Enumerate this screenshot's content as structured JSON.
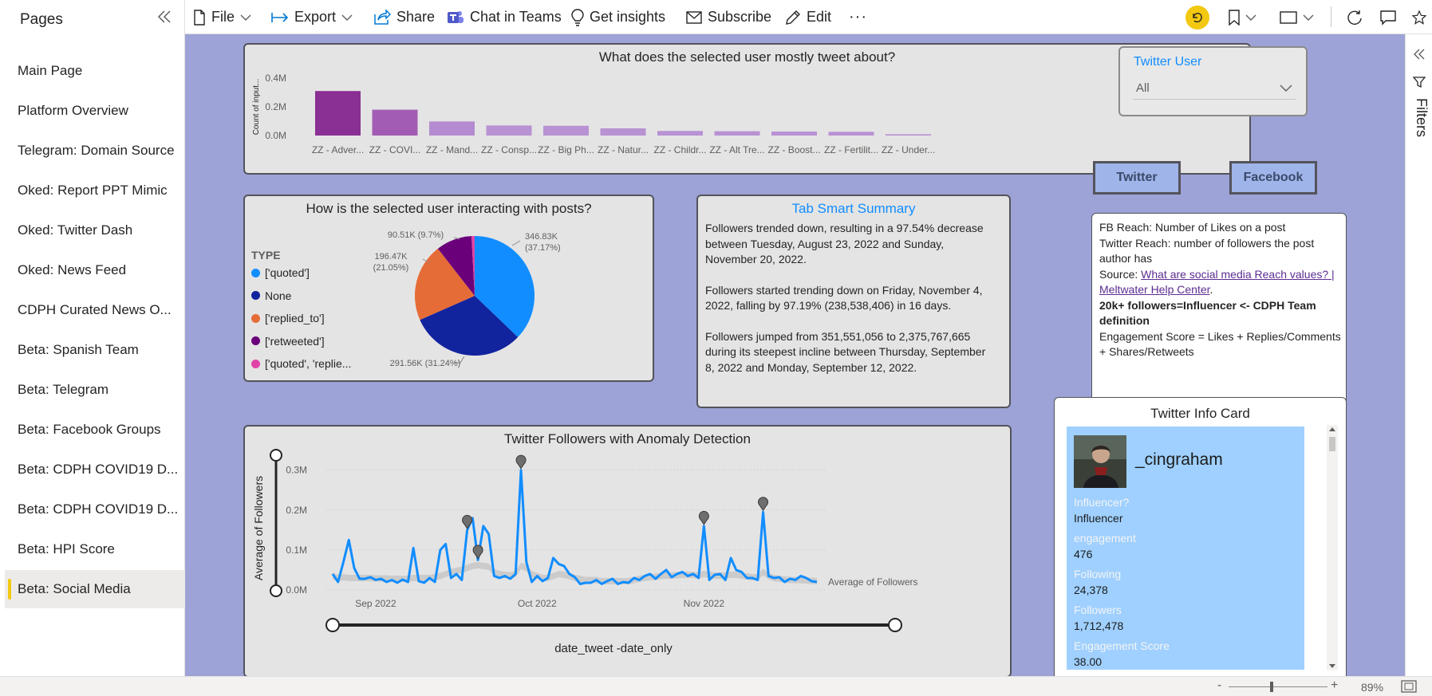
{
  "pages_pane": {
    "title": "Pages",
    "items": [
      {
        "label": "Main Page"
      },
      {
        "label": "Platform Overview"
      },
      {
        "label": "Telegram: Domain Source"
      },
      {
        "label": "Oked: Report PPT Mimic"
      },
      {
        "label": "Oked: Twitter Dash"
      },
      {
        "label": "Oked: News Feed"
      },
      {
        "label": "CDPH Curated News O..."
      },
      {
        "label": "Beta: Spanish Team"
      },
      {
        "label": "Beta: Telegram"
      },
      {
        "label": "Beta: Facebook Groups"
      },
      {
        "label": "Beta: CDPH COVID19 D..."
      },
      {
        "label": "Beta: CDPH COVID19 D..."
      },
      {
        "label": "Beta: HPI Score"
      },
      {
        "label": "Beta: Social Media"
      }
    ],
    "active_index": 13
  },
  "toolbar": {
    "file": "File",
    "export": "Export",
    "share": "Share",
    "chat_in_teams": "Chat in Teams",
    "get_insights": "Get insights",
    "subscribe": "Subscribe",
    "edit": "Edit",
    "more": "···"
  },
  "filters_pane": {
    "label": "Filters"
  },
  "status_bar": {
    "zoom": "89%",
    "minus": "-",
    "plus": "+"
  },
  "slicer": {
    "title": "Twitter User",
    "selected": "All"
  },
  "buttons": {
    "twitter": "Twitter",
    "facebook": "Facebook"
  },
  "smart_summary": {
    "title": "Tab Smart Summary",
    "paragraphs": [
      "Followers trended down, resulting in a 97.54% decrease between Tuesday, August 23, 2022 and Sunday, November 20, 2022.",
      "Followers started trending down on Friday, November 4, 2022, falling by 97.19% (238,538,406) in 16 days.",
      "Followers jumped from 351,551,056 to 2,375,767,665 during its steepest incline between Thursday, September 8, 2022 and Monday, September 12, 2022."
    ]
  },
  "info_text": {
    "line1": "FB Reach: Number of Likes on a post",
    "line2": "Twitter Reach: number of followers the post author has",
    "source_prefix": "Source: ",
    "source_link": "What are social media Reach values? | Meltwater Help Center",
    "source_suffix": ".",
    "bold_def": "20k+ followers=Influencer <- CDPH Team definition",
    "engagement_def": "Engagement Score = Likes + Replies/Comments + Shares/Retweets"
  },
  "info_card": {
    "title": "Twitter Info Card",
    "username": "_cingraham",
    "fields": [
      {
        "label": "Influencer?",
        "value": "Influencer"
      },
      {
        "label": "engagement",
        "value": "476"
      },
      {
        "label": "Following",
        "value": "24,378"
      },
      {
        "label": "Followers",
        "value": "1,712,478"
      },
      {
        "label": "Engagement Score",
        "value": "38.00"
      }
    ]
  },
  "chart_data": [
    {
      "type": "bar",
      "title": "What does the selected user mostly tweet about?",
      "ylabel": "Count of input...",
      "ytick_labels": [
        "0.0M",
        "0.2M",
        "0.4M"
      ],
      "ylim": [
        0,
        400000
      ],
      "categories": [
        "ZZ - Adver...",
        "ZZ - COVI...",
        "ZZ - Mand...",
        "ZZ - Consp...",
        "ZZ - Big Ph...",
        "ZZ - Natur...",
        "ZZ - Childr...",
        "ZZ - Alt Tre...",
        "ZZ - Boost...",
        "ZZ - Fertilit...",
        "ZZ - Under..."
      ],
      "values": [
        310000,
        180000,
        98000,
        70000,
        68000,
        50000,
        32000,
        30000,
        28000,
        26000,
        9000
      ],
      "colors": [
        "#8a2f94",
        "#a35cb3",
        "#b48bd0",
        "#b892d3",
        "#b892d3",
        "#b892d3",
        "#b892d3",
        "#b892d3",
        "#b892d3",
        "#b892d3",
        "#b892d3"
      ]
    },
    {
      "type": "pie",
      "title": "How is the selected user interacting with posts?",
      "legend_title": "TYPE",
      "legend_position": "left",
      "slices": [
        {
          "name": "['quoted']",
          "value": 346830,
          "label": "346.83K (37.17%)",
          "color": "#118dff"
        },
        {
          "name": "None",
          "value": 291560,
          "label": "291.56K (31.24%)",
          "color": "#12239e"
        },
        {
          "name": "['replied_to']",
          "value": 196470,
          "label": "196.47K (21.05%)",
          "color": "#e66c37"
        },
        {
          "name": "['retweeted']",
          "value": 90510,
          "label": "90.51K (9.7%)",
          "color": "#6b007b"
        },
        {
          "name": "['quoted', 'replie...",
          "value": 7900,
          "label": "",
          "color": "#e044a7"
        }
      ]
    },
    {
      "type": "line",
      "title": "Twitter Followers with Anomaly Detection",
      "xlabel": "date_tweet -date_only",
      "ylabel": "Average of Followers",
      "series_label": "Average of Followers",
      "ytick_labels": [
        "0.0M",
        "0.1M",
        "0.2M",
        "0.3M"
      ],
      "ylim": [
        0,
        300000
      ],
      "xtick_labels": [
        {
          "label": "Sep 2022",
          "index": 8
        },
        {
          "label": "Oct 2022",
          "index": 38
        },
        {
          "label": "Nov 2022",
          "index": 69
        }
      ],
      "series": [
        {
          "name": "Average of Followers",
          "color": "#118dff",
          "values": [
            40000,
            20000,
            70000,
            125000,
            55000,
            28000,
            28000,
            32000,
            25000,
            28000,
            20000,
            25000,
            18000,
            26000,
            20000,
            105000,
            22000,
            18000,
            30000,
            20000,
            100000,
            115000,
            30000,
            40000,
            25000,
            150000,
            180000,
            75000,
            160000,
            140000,
            35000,
            30000,
            35000,
            28000,
            40000,
            300000,
            70000,
            20000,
            35000,
            22000,
            30000,
            80000,
            65000,
            60000,
            40000,
            32000,
            15000,
            18000,
            18000,
            25000,
            15000,
            22000,
            28000,
            15000,
            20000,
            18000,
            30000,
            25000,
            35000,
            40000,
            28000,
            40000,
            50000,
            32000,
            40000,
            45000,
            35000,
            40000,
            30000,
            160000,
            25000,
            38000,
            40000,
            25000,
            80000,
            50000,
            45000,
            30000,
            30000,
            25000,
            195000,
            35000,
            30000,
            32000,
            20000,
            28000,
            25000,
            35000,
            30000,
            22000,
            20000
          ]
        },
        {
          "name": "expected range",
          "color": "#bdbdbd",
          "values": [
            35000,
            30000,
            32000,
            30000,
            30000,
            30000,
            30000,
            30000,
            29000,
            29000,
            29000,
            28000,
            28000,
            28000,
            28000,
            30000,
            30000,
            30000,
            30000,
            32000,
            35000,
            40000,
            45000,
            48000,
            50000,
            55000,
            60000,
            62000,
            60000,
            58000,
            45000,
            40000,
            38000,
            36000,
            40000,
            60000,
            55000,
            40000,
            35000,
            30000,
            30000,
            35000,
            40000,
            38000,
            35000,
            30000,
            28000,
            25000,
            25000,
            25000,
            22000,
            22000,
            22000,
            22000,
            22000,
            22000,
            25000,
            28000,
            30000,
            32000,
            33000,
            35000,
            36000,
            36000,
            37000,
            38000,
            38000,
            38000,
            36000,
            40000,
            38000,
            36000,
            36000,
            36000,
            38000,
            38000,
            36000,
            34000,
            32000,
            32000,
            45000,
            35000,
            30000,
            28000,
            26000,
            25000,
            25000,
            25000,
            24000,
            23000,
            22000
          ]
        }
      ],
      "anomaly_indices": [
        25,
        27,
        35,
        69,
        80
      ]
    }
  ]
}
